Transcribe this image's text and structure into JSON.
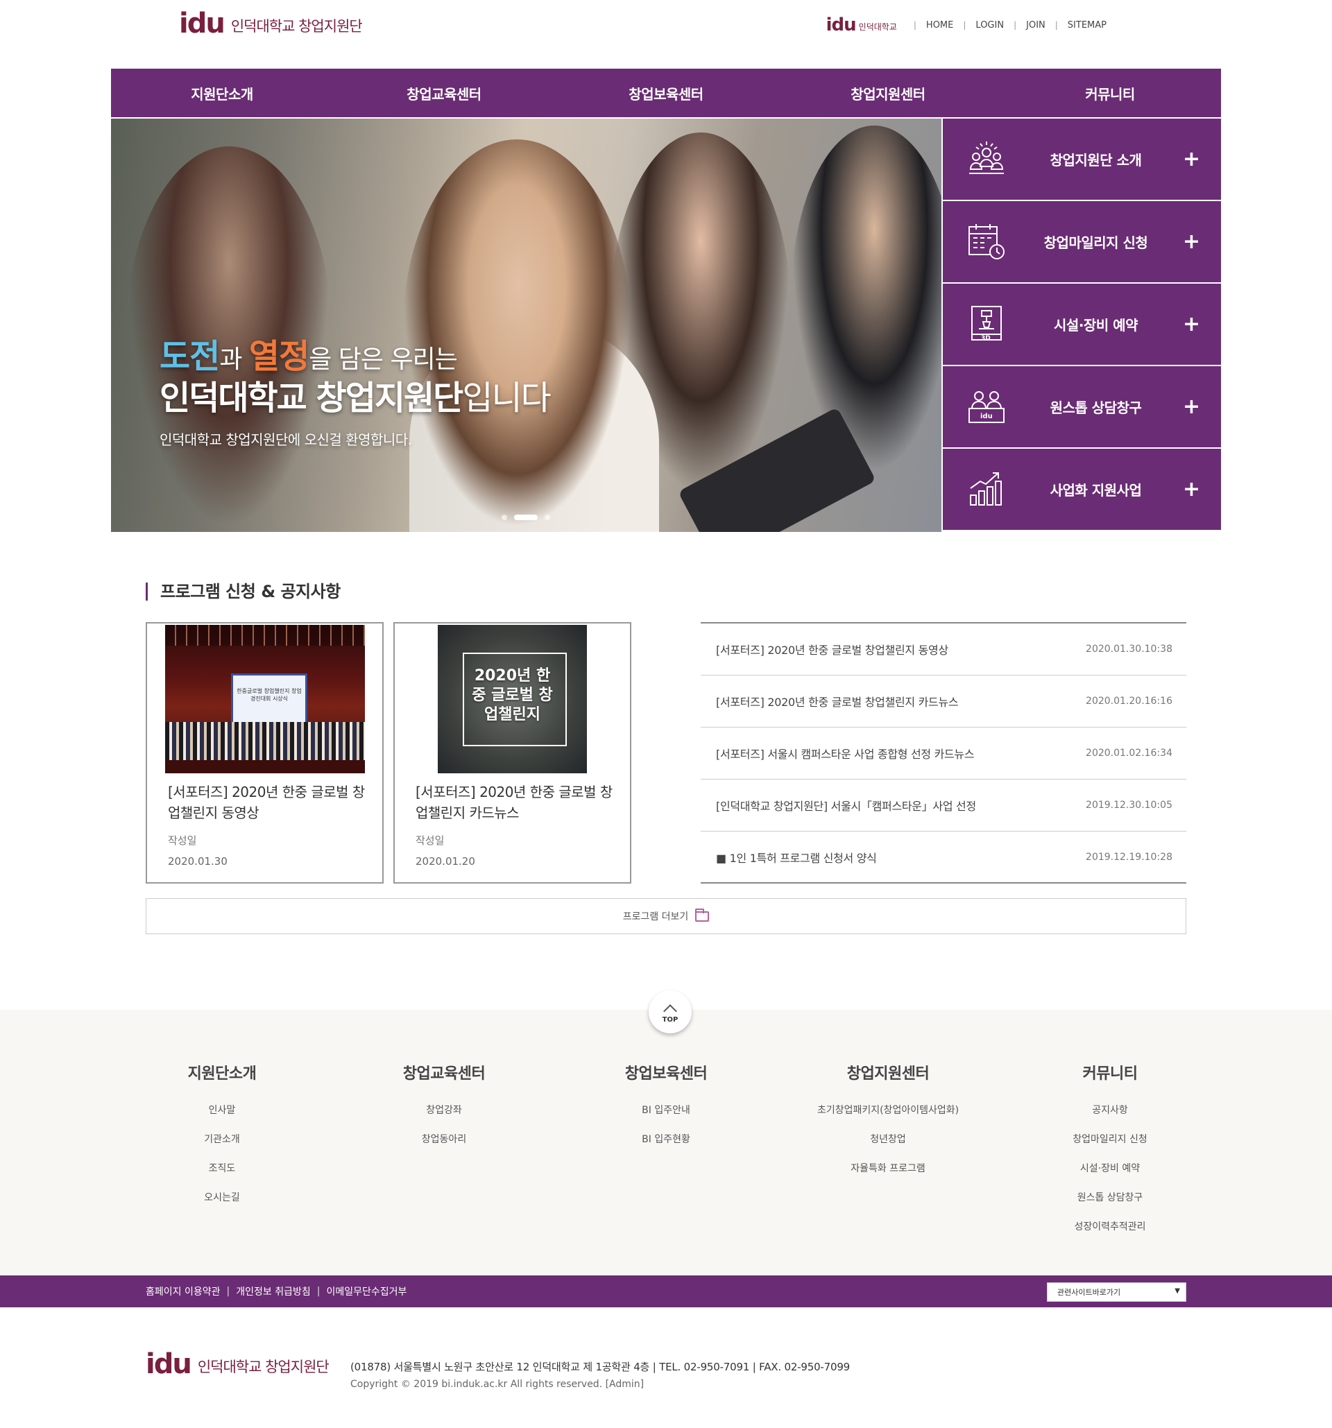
{
  "header": {
    "logo_mark": "idu",
    "logo_text": "인덕대학교 창업지원단",
    "util_logo_mark": "idu",
    "util_logo_text": "인덕대학교",
    "util_links": [
      "HOME",
      "LOGIN",
      "JOIN",
      "SITEMAP"
    ]
  },
  "nav": [
    "지원단소개",
    "창업교육센터",
    "창업보육센터",
    "창업지원센터",
    "커뮤니티"
  ],
  "hero": {
    "w1": "도전",
    "w2": "과 ",
    "w3": "열정",
    "w4": "을 담은 우리는",
    "line2_bold": "인덕대학교 창업지원단",
    "line2_rest": "입니다",
    "line3": "인덕대학교 창업지원단에 오신걸 환영합니다.",
    "slide_count": 3,
    "active_slide": 2
  },
  "quick_menu": [
    {
      "label": "창업지원단 소개",
      "icon": "group-people-icon"
    },
    {
      "label": "창업마일리지 신청",
      "icon": "calendar-clock-icon"
    },
    {
      "label": "시설·장비 예약",
      "icon": "3d-printer-icon"
    },
    {
      "label": "원스톱 상담창구",
      "icon": "consultation-desk-icon"
    },
    {
      "label": "사업화 지원사업",
      "icon": "growth-chart-icon"
    }
  ],
  "quick_plus": "+",
  "section_title": "프로그램 신청 & 공지사항",
  "cards": [
    {
      "title": "[서포터즈] 2020년 한중 글로벌 창업챌린지 동영상",
      "label": "작성일",
      "date": "2020.01.30",
      "thumb_text": "한중글로벌 창업챌린지 창업경진대회 시상식"
    },
    {
      "title": "[서포터즈] 2020년 한중 글로벌 창업챌린지 카드뉴스",
      "label": "작성일",
      "date": "2020.01.20",
      "thumb_text": "2020년 한중 글로벌 창업챌린지"
    }
  ],
  "notices": [
    {
      "title": "[서포터즈] 2020년 한중 글로벌 창업챌린지 동영상",
      "date": "2020.01.30.10:38"
    },
    {
      "title": "[서포터즈] 2020년 한중 글로벌 창업챌린지 카드뉴스",
      "date": "2020.01.20.16:16"
    },
    {
      "title": "[서포터즈] 서울시 캠퍼스타운 사업 종합형 선정 카드뉴스",
      "date": "2020.01.02.16:34"
    },
    {
      "title": "[인덕대학교 창업지원단] 서울시「캠퍼스타운」사업 선정",
      "date": "2019.12.30.10:05"
    },
    {
      "title": "■ 1인 1특허 프로그램 신청서 양식",
      "date": "2019.12.19.10:28"
    }
  ],
  "more_label": "프로그램 더보기",
  "top_label": "TOP",
  "sitemap": [
    {
      "head": "지원단소개",
      "links": [
        "인사말",
        "기관소개",
        "조직도",
        "오시는길"
      ]
    },
    {
      "head": "창업교육센터",
      "links": [
        "창업강좌",
        "창업동아리"
      ]
    },
    {
      "head": "창업보육센터",
      "links": [
        "BI 입주안내",
        "BI 입주현황"
      ]
    },
    {
      "head": "창업지원센터",
      "links": [
        "초기창업패키지(창업아이템사업화)",
        "청년창업",
        "자율특화 프로그램"
      ]
    },
    {
      "head": "커뮤니티",
      "links": [
        "공지사항",
        "창업마일리지 신청",
        "시설·장비 예약",
        "원스톱 상담창구",
        "성장이력추적관리"
      ]
    }
  ],
  "footer": {
    "links": [
      "홈페이지 이용약관",
      "개인정보 취급방침",
      "이메일무단수집거부"
    ],
    "select_label": "관련사이트바로가기",
    "logo_mark": "idu",
    "logo_text": "인덕대학교 창업지원단",
    "address": "(01878) 서울특별시 노원구 초안산로 12 인덕대학교 제 1공학관 4층  |  TEL. 02-950-7091  |  FAX. 02-950-7099",
    "copyright": "Copyright © 2019 bi.induk.ac.kr All rights reserved. [Admin]"
  },
  "colors": {
    "brand_purple": "#6a2c74",
    "logo_maroon": "#7a1f3d",
    "hero_blue": "#5fc0e8",
    "hero_orange": "#f2793a"
  }
}
